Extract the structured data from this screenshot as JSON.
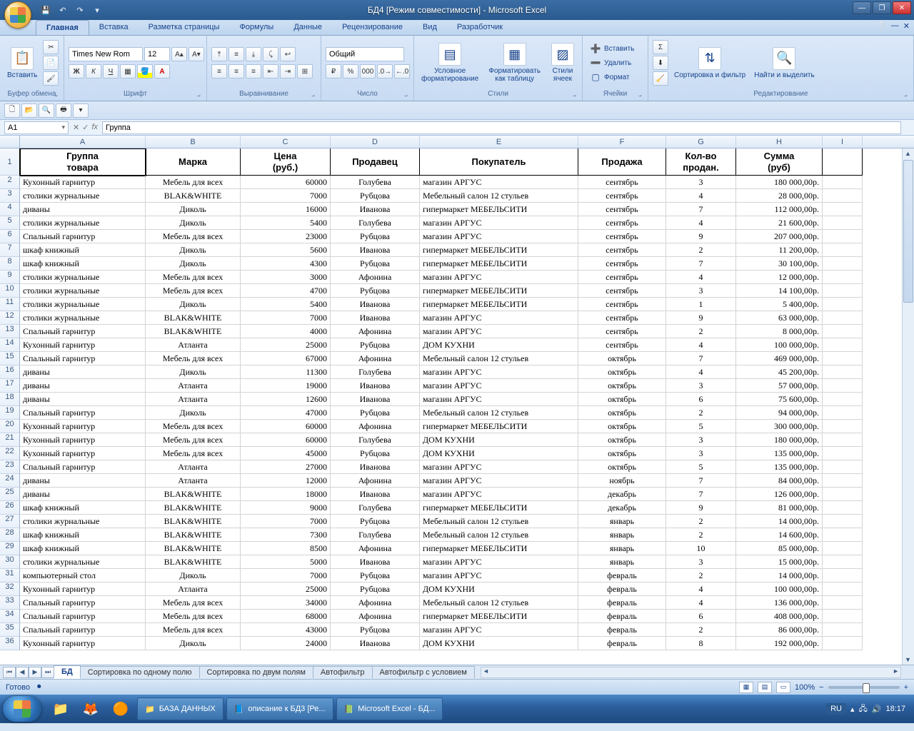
{
  "window": {
    "title": "БД4  [Режим совместимости] - Microsoft Excel"
  },
  "ribbon": {
    "tabs": [
      "Главная",
      "Вставка",
      "Разметка страницы",
      "Формулы",
      "Данные",
      "Рецензирование",
      "Вид",
      "Разработчик"
    ],
    "active_tab": 0,
    "groups": {
      "clipboard": {
        "label": "Буфер обмена",
        "paste": "Вставить"
      },
      "font": {
        "label": "Шрифт",
        "family": "Times New Rom",
        "size": "12"
      },
      "align": {
        "label": "Выравнивание"
      },
      "number": {
        "label": "Число",
        "format": "Общий"
      },
      "styles": {
        "label": "Стили",
        "cond": "Условное форматирование",
        "table": "Форматировать как таблицу",
        "cell": "Стили ячеек"
      },
      "cells": {
        "label": "Ячейки",
        "insert": "Вставить",
        "delete": "Удалить",
        "format": "Формат"
      },
      "editing": {
        "label": "Редактирование",
        "sort": "Сортировка и фильтр",
        "find": "Найти и выделить"
      }
    }
  },
  "namebox": "A1",
  "formula": "Группа",
  "columns": [
    "A",
    "B",
    "C",
    "D",
    "E",
    "F",
    "G",
    "H",
    "I"
  ],
  "headers": {
    "A": "Группа\nтовара",
    "B": "Марка",
    "C": "Цена\n(руб.)",
    "D": "Продавец",
    "E": "Покупатель",
    "F": "Продажа",
    "G": "Кол-во\nпродан.",
    "H": "Сумма\n(руб)"
  },
  "rows": [
    {
      "n": 2,
      "A": "Кухонный гарнитур",
      "B": "Мебель для всех",
      "C": "60000",
      "D": "Голубева",
      "E": "магазин АРГУС",
      "F": "сентябрь",
      "G": "3",
      "H": "180 000,00р."
    },
    {
      "n": 3,
      "A": "столики журнальные",
      "B": "BLAK&WHITE",
      "C": "7000",
      "D": "Рубцова",
      "E": "Мебельный салон 12 стульев",
      "F": "сентябрь",
      "G": "4",
      "H": "28 000,00р."
    },
    {
      "n": 4,
      "A": "диваны",
      "B": "Диколь",
      "C": "16000",
      "D": "Иванова",
      "E": "гипермаркет МЕБЕЛЬСИТИ",
      "F": "сентябрь",
      "G": "7",
      "H": "112 000,00р."
    },
    {
      "n": 5,
      "A": "столики журнальные",
      "B": "Диколь",
      "C": "5400",
      "D": "Голубева",
      "E": "магазин АРГУС",
      "F": "сентябрь",
      "G": "4",
      "H": "21 600,00р."
    },
    {
      "n": 6,
      "A": "Спальный гарнитур",
      "B": "Мебель для всех",
      "C": "23000",
      "D": "Рубцова",
      "E": "магазин АРГУС",
      "F": "сентябрь",
      "G": "9",
      "H": "207 000,00р."
    },
    {
      "n": 7,
      "A": "шкаф книжный",
      "B": "Диколь",
      "C": "5600",
      "D": "Иванова",
      "E": "гипермаркет МЕБЕЛЬСИТИ",
      "F": "сентябрь",
      "G": "2",
      "H": "11 200,00р."
    },
    {
      "n": 8,
      "A": "шкаф книжный",
      "B": "Диколь",
      "C": "4300",
      "D": "Рубцова",
      "E": "гипермаркет МЕБЕЛЬСИТИ",
      "F": "сентябрь",
      "G": "7",
      "H": "30 100,00р."
    },
    {
      "n": 9,
      "A": "столики журнальные",
      "B": "Мебель для всех",
      "C": "3000",
      "D": "Афонина",
      "E": "магазин АРГУС",
      "F": "сентябрь",
      "G": "4",
      "H": "12 000,00р."
    },
    {
      "n": 10,
      "A": "столики журнальные",
      "B": "Мебель для всех",
      "C": "4700",
      "D": "Рубцова",
      "E": "гипермаркет МЕБЕЛЬСИТИ",
      "F": "сентябрь",
      "G": "3",
      "H": "14 100,00р."
    },
    {
      "n": 11,
      "A": "столики журнальные",
      "B": "Диколь",
      "C": "5400",
      "D": "Иванова",
      "E": "гипермаркет МЕБЕЛЬСИТИ",
      "F": "сентябрь",
      "G": "1",
      "H": "5 400,00р."
    },
    {
      "n": 12,
      "A": "столики журнальные",
      "B": "BLAK&WHITE",
      "C": "7000",
      "D": "Иванова",
      "E": "магазин АРГУС",
      "F": "сентябрь",
      "G": "9",
      "H": "63 000,00р."
    },
    {
      "n": 13,
      "A": "Спальный гарнитур",
      "B": "BLAK&WHITE",
      "C": "4000",
      "D": "Афонина",
      "E": "магазин АРГУС",
      "F": "сентябрь",
      "G": "2",
      "H": "8 000,00р."
    },
    {
      "n": 14,
      "A": "Кухонный гарнитур",
      "B": "Атланта",
      "C": "25000",
      "D": "Рубцова",
      "E": "ДОМ КУХНИ",
      "F": "сентябрь",
      "G": "4",
      "H": "100 000,00р."
    },
    {
      "n": 15,
      "A": "Спальный гарнитур",
      "B": "Мебель для всех",
      "C": "67000",
      "D": "Афонина",
      "E": "Мебельный салон 12 стульев",
      "F": "октябрь",
      "G": "7",
      "H": "469 000,00р."
    },
    {
      "n": 16,
      "A": "диваны",
      "B": "Диколь",
      "C": "11300",
      "D": "Голубева",
      "E": "магазин АРГУС",
      "F": "октябрь",
      "G": "4",
      "H": "45 200,00р."
    },
    {
      "n": 17,
      "A": "диваны",
      "B": "Атланта",
      "C": "19000",
      "D": "Иванова",
      "E": "магазин АРГУС",
      "F": "октябрь",
      "G": "3",
      "H": "57 000,00р."
    },
    {
      "n": 18,
      "A": "диваны",
      "B": "Атланта",
      "C": "12600",
      "D": "Иванова",
      "E": "магазин АРГУС",
      "F": "октябрь",
      "G": "6",
      "H": "75 600,00р."
    },
    {
      "n": 19,
      "A": "Спальный гарнитур",
      "B": "Диколь",
      "C": "47000",
      "D": "Рубцова",
      "E": "Мебельный салон 12 стульев",
      "F": "октябрь",
      "G": "2",
      "H": "94 000,00р."
    },
    {
      "n": 20,
      "A": "Кухонный гарнитур",
      "B": "Мебель для всех",
      "C": "60000",
      "D": "Афонина",
      "E": "гипермаркет МЕБЕЛЬСИТИ",
      "F": "октябрь",
      "G": "5",
      "H": "300 000,00р."
    },
    {
      "n": 21,
      "A": "Кухонный гарнитур",
      "B": "Мебель для всех",
      "C": "60000",
      "D": "Голубева",
      "E": "ДОМ КУХНИ",
      "F": "октябрь",
      "G": "3",
      "H": "180 000,00р."
    },
    {
      "n": 22,
      "A": "Кухонный гарнитур",
      "B": "Мебель для всех",
      "C": "45000",
      "D": "Рубцова",
      "E": "ДОМ КУХНИ",
      "F": "октябрь",
      "G": "3",
      "H": "135 000,00р."
    },
    {
      "n": 23,
      "A": "Спальный гарнитур",
      "B": "Атланта",
      "C": "27000",
      "D": "Иванова",
      "E": "магазин АРГУС",
      "F": "октябрь",
      "G": "5",
      "H": "135 000,00р."
    },
    {
      "n": 24,
      "A": "диваны",
      "B": "Атланта",
      "C": "12000",
      "D": "Афонина",
      "E": "магазин АРГУС",
      "F": "ноябрь",
      "G": "7",
      "H": "84 000,00р."
    },
    {
      "n": 25,
      "A": "диваны",
      "B": "BLAK&WHITE",
      "C": "18000",
      "D": "Иванова",
      "E": "магазин АРГУС",
      "F": "декабрь",
      "G": "7",
      "H": "126 000,00р."
    },
    {
      "n": 26,
      "A": "шкаф книжный",
      "B": "BLAK&WHITE",
      "C": "9000",
      "D": "Голубева",
      "E": "гипермаркет МЕБЕЛЬСИТИ",
      "F": "декабрь",
      "G": "9",
      "H": "81 000,00р."
    },
    {
      "n": 27,
      "A": "столики журнальные",
      "B": "BLAK&WHITE",
      "C": "7000",
      "D": "Рубцова",
      "E": "Мебельный салон 12 стульев",
      "F": "январь",
      "G": "2",
      "H": "14 000,00р."
    },
    {
      "n": 28,
      "A": "шкаф книжный",
      "B": "BLAK&WHITE",
      "C": "7300",
      "D": "Голубева",
      "E": "Мебельный салон 12 стульев",
      "F": "январь",
      "G": "2",
      "H": "14 600,00р."
    },
    {
      "n": 29,
      "A": "шкаф книжный",
      "B": "BLAK&WHITE",
      "C": "8500",
      "D": "Афонина",
      "E": "гипермаркет МЕБЕЛЬСИТИ",
      "F": "январь",
      "G": "10",
      "H": "85 000,00р."
    },
    {
      "n": 30,
      "A": "столики журнальные",
      "B": "BLAK&WHITE",
      "C": "5000",
      "D": "Иванова",
      "E": "магазин АРГУС",
      "F": "январь",
      "G": "3",
      "H": "15 000,00р."
    },
    {
      "n": 31,
      "A": "компьютерный стол",
      "B": "Диколь",
      "C": "7000",
      "D": "Рубцова",
      "E": "магазин АРГУС",
      "F": "февраль",
      "G": "2",
      "H": "14 000,00р."
    },
    {
      "n": 32,
      "A": "Кухонный гарнитур",
      "B": "Атланта",
      "C": "25000",
      "D": "Рубцова",
      "E": "ДОМ КУХНИ",
      "F": "февраль",
      "G": "4",
      "H": "100 000,00р."
    },
    {
      "n": 33,
      "A": "Спальный гарнитур",
      "B": "Мебель для всех",
      "C": "34000",
      "D": "Афонина",
      "E": "Мебельный салон 12 стульев",
      "F": "февраль",
      "G": "4",
      "H": "136 000,00р."
    },
    {
      "n": 34,
      "A": "Спальный гарнитур",
      "B": "Мебель для всех",
      "C": "68000",
      "D": "Афонина",
      "E": "гипермаркет МЕБЕЛЬСИТИ",
      "F": "февраль",
      "G": "6",
      "H": "408 000,00р."
    },
    {
      "n": 35,
      "A": "Спальный гарнитур",
      "B": "Мебель для всех",
      "C": "43000",
      "D": "Рубцова",
      "E": "магазин АРГУС",
      "F": "февраль",
      "G": "2",
      "H": "86 000,00р."
    },
    {
      "n": 36,
      "A": "Кухонный гарнитур",
      "B": "Диколь",
      "C": "24000",
      "D": "Иванова",
      "E": "ДОМ КУХНИ",
      "F": "февраль",
      "G": "8",
      "H": "192 000,00р."
    }
  ],
  "sheets": [
    "БД",
    "Сортировка по одному полю",
    "Сортировка по двум полям",
    "Автофильтр",
    "Автофильтр с условием"
  ],
  "active_sheet": 0,
  "status": {
    "ready": "Готово",
    "zoom": "100%"
  },
  "taskbar": {
    "tasks": [
      "БАЗА ДАННЫХ",
      "описание к БД3 [Ре...",
      "Microsoft Excel - БД..."
    ],
    "lang": "RU",
    "time": "18:17"
  }
}
